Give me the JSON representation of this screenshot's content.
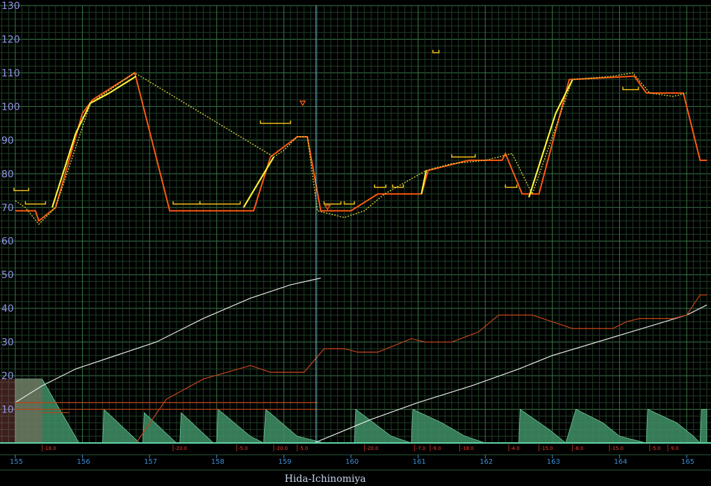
{
  "station": "Hida-Ichinomiya",
  "colors": {
    "background": "#000000",
    "grid_minor": "#1f3f26",
    "grid_major": "#3b7a4c",
    "speed_limit": "#ff3a14",
    "speed_run": "#fff23a",
    "speed_coast": "#d7d23a",
    "speed_brake": "#ff5a14",
    "time_curve": "#e8e8e8",
    "energy": "#b8421a",
    "gradient_fill": "#3f8f66",
    "ylabel": "#8f96e6",
    "xlabel": "#3d8fd6",
    "gradient_text": "#ff3b2e",
    "station_text": "#c9d6f0"
  },
  "chart_data": {
    "type": "line",
    "title": "",
    "xlabel": "",
    "ylabel": "",
    "xlim": [
      155,
      165.3
    ],
    "ylim": [
      0,
      130
    ],
    "grid": true,
    "y_ticks": [
      130,
      120,
      110,
      100,
      90,
      80,
      70,
      60,
      50,
      40,
      30,
      20,
      10
    ],
    "x_ticks": [
      155,
      156,
      157,
      158,
      159,
      160,
      161,
      162,
      163,
      164,
      165
    ],
    "station_marker_km": 159.48,
    "series": [
      {
        "role": "speed_limit",
        "points": [
          [
            155.0,
            69
          ],
          [
            155.3,
            69
          ],
          [
            155.35,
            66
          ],
          [
            155.6,
            70
          ],
          [
            156.0,
            98
          ],
          [
            156.15,
            102
          ],
          [
            156.78,
            110
          ],
          [
            157.3,
            69
          ],
          [
            158.55,
            69
          ],
          [
            158.8,
            85
          ],
          [
            159.2,
            91
          ],
          [
            159.35,
            91
          ],
          [
            159.55,
            69
          ],
          [
            160.0,
            69
          ],
          [
            160.4,
            74
          ],
          [
            161.05,
            74
          ],
          [
            161.15,
            81
          ],
          [
            161.75,
            84
          ],
          [
            162.25,
            84
          ],
          [
            162.3,
            86
          ],
          [
            162.55,
            74
          ],
          [
            162.8,
            74
          ],
          [
            163.25,
            108
          ],
          [
            164.22,
            109
          ],
          [
            164.4,
            104
          ],
          [
            164.8,
            104
          ],
          [
            164.95,
            104
          ],
          [
            165.2,
            84
          ],
          [
            165.3,
            84
          ]
        ]
      },
      {
        "role": "speed_run",
        "points": [
          [
            155.55,
            70
          ],
          [
            155.9,
            92
          ],
          [
            156.12,
            101
          ],
          [
            156.4,
            104
          ],
          [
            156.8,
            109
          ],
          [
            158.4,
            70
          ],
          [
            158.85,
            85
          ],
          [
            160.85,
            74
          ],
          [
            161.05,
            74
          ],
          [
            161.12,
            81
          ],
          [
            162.65,
            73
          ],
          [
            163.05,
            98
          ],
          [
            163.3,
            108
          ]
        ]
      },
      {
        "role": "speed_coast",
        "points": [
          [
            155.0,
            72
          ],
          [
            155.15,
            70
          ],
          [
            155.35,
            65
          ],
          [
            155.6,
            70
          ],
          [
            156.12,
            101
          ],
          [
            156.78,
            110
          ],
          [
            158.85,
            85
          ],
          [
            159.0,
            87
          ],
          [
            159.2,
            91
          ],
          [
            159.35,
            91
          ],
          [
            159.5,
            69
          ],
          [
            159.9,
            67
          ],
          [
            160.2,
            69
          ],
          [
            160.5,
            74
          ],
          [
            161.12,
            81
          ],
          [
            161.5,
            83
          ],
          [
            162.0,
            84
          ],
          [
            162.4,
            86
          ],
          [
            162.7,
            74
          ],
          [
            163.3,
            108
          ],
          [
            163.9,
            109
          ],
          [
            164.2,
            110
          ],
          [
            164.45,
            104
          ],
          [
            164.8,
            103
          ],
          [
            165.0,
            104
          ]
        ]
      },
      {
        "role": "time",
        "segments": [
          [
            [
              155.0,
              12
            ],
            [
              155.4,
              17
            ],
            [
              155.9,
              22
            ],
            [
              156.5,
              26
            ],
            [
              157.1,
              30
            ],
            [
              157.8,
              37
            ],
            [
              158.5,
              43
            ],
            [
              159.1,
              47
            ],
            [
              159.55,
              49
            ]
          ],
          [
            [
              159.45,
              0
            ],
            [
              160.3,
              7
            ],
            [
              161.0,
              12
            ],
            [
              161.8,
              17
            ],
            [
              162.5,
              22
            ],
            [
              163.0,
              26
            ],
            [
              163.5,
              29
            ],
            [
              164.0,
              32
            ],
            [
              164.5,
              35
            ],
            [
              165.0,
              38
            ],
            [
              165.3,
              41
            ]
          ]
        ]
      },
      {
        "role": "energy",
        "segments": [
          [
            [
              155.0,
              12
            ],
            [
              155.5,
              12
            ],
            [
              159.5,
              12
            ]
          ],
          [
            [
              155.0,
              10
            ],
            [
              155.5,
              10
            ],
            [
              159.5,
              10
            ]
          ],
          [
            [
              155.4,
              9
            ],
            [
              155.8,
              9
            ]
          ],
          [
            [
              155.0,
              0
            ],
            [
              156.8,
              0
            ],
            [
              157.25,
              13
            ],
            [
              157.8,
              19
            ],
            [
              158.5,
              23
            ],
            [
              158.8,
              21
            ],
            [
              159.3,
              21
            ],
            [
              159.6,
              28
            ],
            [
              159.9,
              28
            ],
            [
              160.1,
              27
            ],
            [
              160.4,
              27
            ],
            [
              160.9,
              31
            ],
            [
              161.1,
              30
            ],
            [
              161.5,
              30
            ],
            [
              161.9,
              33
            ],
            [
              162.2,
              38
            ],
            [
              162.7,
              38
            ],
            [
              163.3,
              34
            ],
            [
              163.9,
              34
            ],
            [
              164.1,
              36
            ],
            [
              164.3,
              37
            ],
            [
              164.8,
              37
            ],
            [
              165.0,
              38
            ],
            [
              165.2,
              44
            ],
            [
              165.3,
              44
            ]
          ]
        ]
      },
      {
        "role": "gradient",
        "profile": [
          [
            155.0,
            0
          ],
          [
            155.0,
            19
          ],
          [
            155.4,
            19
          ],
          [
            155.95,
            0
          ],
          [
            156.3,
            0
          ],
          [
            156.32,
            10
          ],
          [
            156.85,
            0
          ],
          [
            156.9,
            0
          ],
          [
            156.92,
            9
          ],
          [
            157.4,
            0
          ],
          [
            157.45,
            0
          ],
          [
            157.47,
            9
          ],
          [
            157.95,
            0
          ],
          [
            158.0,
            0
          ],
          [
            158.02,
            10
          ],
          [
            158.5,
            2
          ],
          [
            158.7,
            0
          ],
          [
            158.73,
            10
          ],
          [
            159.2,
            2
          ],
          [
            159.6,
            0
          ],
          [
            160.05,
            0
          ],
          [
            160.07,
            10
          ],
          [
            160.6,
            2
          ],
          [
            160.9,
            0
          ],
          [
            160.92,
            10
          ],
          [
            161.35,
            6
          ],
          [
            161.7,
            2
          ],
          [
            162.0,
            0
          ],
          [
            162.5,
            0
          ],
          [
            162.52,
            10
          ],
          [
            162.95,
            4
          ],
          [
            163.2,
            0
          ],
          [
            163.35,
            10
          ],
          [
            163.75,
            6
          ],
          [
            164.0,
            2
          ],
          [
            164.4,
            0
          ],
          [
            164.42,
            10
          ],
          [
            164.85,
            6
          ],
          [
            165.1,
            2
          ],
          [
            165.2,
            0
          ],
          [
            165.22,
            10
          ],
          [
            165.3,
            10
          ],
          [
            165.3,
            0
          ]
        ],
        "labels": [
          {
            "km": 155.4,
            "text": "-18.0"
          },
          {
            "km": 157.35,
            "text": "-20.0"
          },
          {
            "km": 158.3,
            "text": "-5.0"
          },
          {
            "km": 158.85,
            "text": "-20.0"
          },
          {
            "km": 159.2,
            "text": "-5.0"
          },
          {
            "km": 160.2,
            "text": "-20.0"
          },
          {
            "km": 160.95,
            "text": "-7.0"
          },
          {
            "km": 161.18,
            "text": "-9.0"
          },
          {
            "km": 161.62,
            "text": "-18.0"
          },
          {
            "km": 162.35,
            "text": "-4.0"
          },
          {
            "km": 162.8,
            "text": "-15.0"
          },
          {
            "km": 163.3,
            "text": "-8.0"
          },
          {
            "km": 163.85,
            "text": "-15.0"
          },
          {
            "km": 164.45,
            "text": "-5.0"
          },
          {
            "km": 164.72,
            "text": "-9.0"
          }
        ]
      }
    ],
    "annotations": [
      {
        "kind": "bracket",
        "x1": 154.98,
        "x2": 155.2,
        "y": 75
      },
      {
        "kind": "bracket",
        "x1": 155.15,
        "x2": 155.45,
        "y": 71
      },
      {
        "kind": "bracket",
        "x1": 157.35,
        "x2": 157.75,
        "y": 71
      },
      {
        "kind": "bracket",
        "x1": 157.75,
        "x2": 158.35,
        "y": 71
      },
      {
        "kind": "bracket",
        "x1": 158.65,
        "x2": 159.1,
        "y": 95
      },
      {
        "kind": "bracket",
        "x1": 159.6,
        "x2": 159.85,
        "y": 71
      },
      {
        "kind": "bracket",
        "x1": 159.9,
        "x2": 160.05,
        "y": 71
      },
      {
        "kind": "bracket",
        "x1": 160.35,
        "x2": 160.52,
        "y": 76
      },
      {
        "kind": "bracket",
        "x1": 160.62,
        "x2": 160.78,
        "y": 76
      },
      {
        "kind": "bracket",
        "x1": 161.5,
        "x2": 161.85,
        "y": 85
      },
      {
        "kind": "bracket",
        "x1": 162.3,
        "x2": 162.47,
        "y": 76
      },
      {
        "kind": "bracket",
        "x1": 164.05,
        "x2": 164.28,
        "y": 105
      },
      {
        "kind": "bracket",
        "x1": 161.22,
        "x2": 161.31,
        "y": 116
      },
      {
        "kind": "triangle",
        "x": 159.28,
        "y": 101
      },
      {
        "kind": "triangle",
        "x": 159.65,
        "y": 70
      }
    ]
  }
}
